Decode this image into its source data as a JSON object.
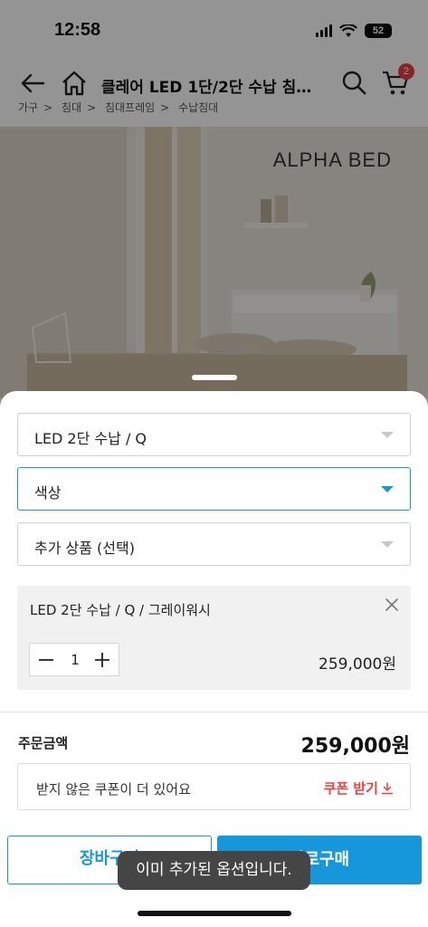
{
  "status_bar": {
    "time": "12:58",
    "battery": "52",
    "icons": [
      "signal-icon",
      "wifi-icon",
      "battery-icon"
    ]
  },
  "nav": {
    "title": "클레어 LED 1단/2단 수납 침대...",
    "cart_count": "2",
    "icons": [
      "back-arrow-icon",
      "home-icon",
      "search-icon",
      "cart-icon"
    ]
  },
  "breadcrumb": [
    "가구",
    "침대",
    "침대프레임",
    "수납침대"
  ],
  "hero": {
    "brand_text": "ALPHA BED"
  },
  "sheet": {
    "selects": [
      {
        "label": "LED 2단 수납 / Q",
        "active": false
      },
      {
        "label": "색상",
        "active": true
      },
      {
        "label": "추가 상품 (선택)",
        "active": false
      }
    ],
    "selected_option": {
      "name": "LED 2단 수납 / Q / 그레이워시",
      "quantity": "1",
      "price": "259,000원"
    },
    "total": {
      "label": "주문금액",
      "price": "259,000원"
    },
    "coupon": {
      "text": "받지 않은 쿠폰이 더 있어요",
      "link": "쿠폰 받기"
    },
    "buttons": {
      "cart": "장바구니",
      "buy": "바로구매"
    }
  },
  "toast": {
    "message": "이미 추가된 옵션입니다."
  },
  "colors": {
    "accent": "#1697db",
    "coupon_red": "#e8413e",
    "badge_red": "#e8413e",
    "toast_bg": "#454545"
  }
}
